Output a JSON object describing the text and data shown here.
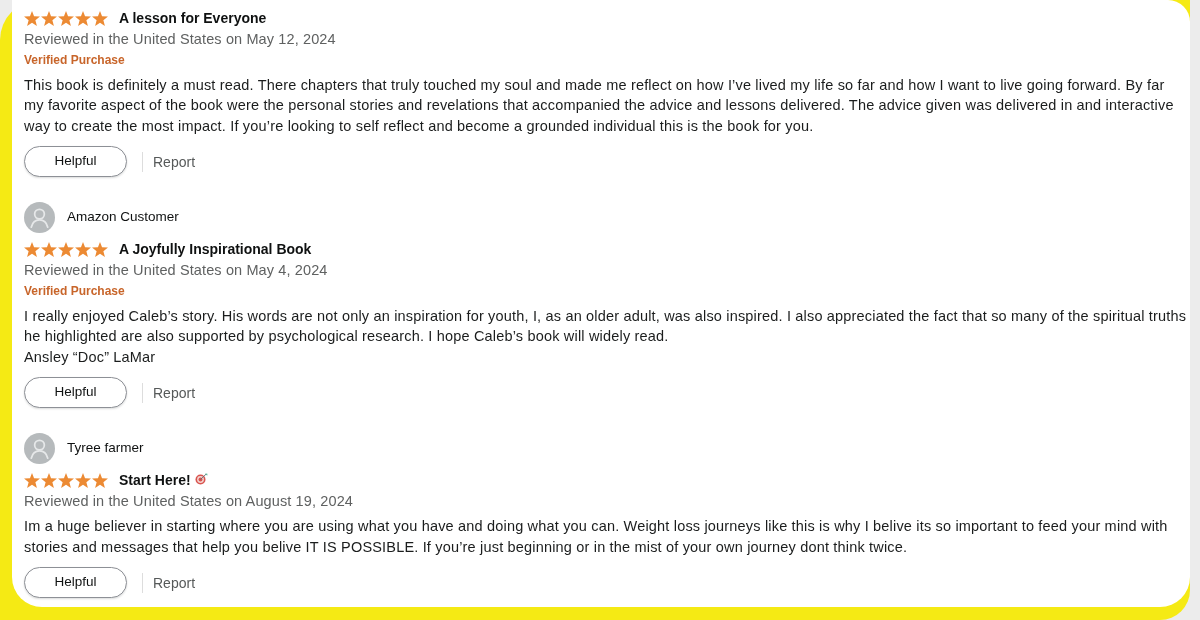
{
  "reviews": [
    {
      "title": "A lesson for Everyone",
      "stars": 5,
      "title_icon": false,
      "date": "Reviewed in the United States on May 12, 2024",
      "badge": "Verified Purchase",
      "body": "This book is definitely a must read. There chapters that truly touched my soul and made me reflect on how I’ve lived my life so far and how I want to live going forward. By far my favorite aspect of the book were the personal stories and revelations that accompanied the advice and lessons delivered. The advice given was delivered in and interactive way to create the most impact. If you’re looking to self reflect and become a grounded individual this is the book for you.",
      "helpful": "Helpful",
      "report": "Report"
    },
    {
      "author": "Amazon Customer",
      "title": "A Joyfully Inspirational Book",
      "stars": 5,
      "title_icon": false,
      "date": "Reviewed in the United States on May 4, 2024",
      "badge": "Verified Purchase",
      "body": "I really enjoyed Caleb’s story. His words are not only an inspiration for youth, I, as an older adult, was also inspired. I also appreciated the fact that so many of the spiritual truths he highlighted are also supported by psychological research. I hope Caleb’s book will widely read.\nAnsley “Doc” LaMar",
      "helpful": "Helpful",
      "report": "Report"
    },
    {
      "author": "Tyree farmer",
      "title": "Start Here!",
      "stars": 5,
      "title_icon": true,
      "date": "Reviewed in the United States on August 19, 2024",
      "body": "Im a huge believer in starting where you are using what you have and doing what you can. Weight loss journeys like this is why I belive its so important to feed your mind with stories and messages that help you belive IT IS POSSIBLE. If you’re just beginning or in the mist of your own journey dont think twice.",
      "helpful": "Helpful",
      "report": "Report"
    }
  ]
}
